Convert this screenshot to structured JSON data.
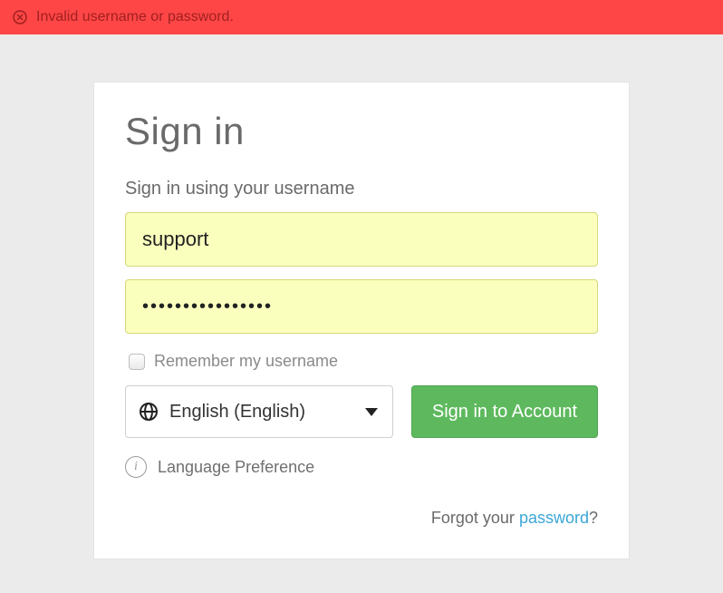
{
  "error": {
    "message": "Invalid username or password."
  },
  "card": {
    "title": "Sign in",
    "subtitle": "Sign in using your username",
    "username_value": "support",
    "password_value": "••••••••••••••••",
    "remember_label": "Remember my username",
    "language": {
      "selected": "English (English)",
      "pref_label": "Language Preference"
    },
    "signin_button": "Sign in to Account",
    "forgot": {
      "prefix": "Forgot your ",
      "link": "password",
      "suffix": "?"
    }
  },
  "colors": {
    "error_bg": "#ff4646",
    "accent_green": "#5eb95e",
    "link": "#3aa7d6",
    "field_bg": "#faffbd"
  }
}
